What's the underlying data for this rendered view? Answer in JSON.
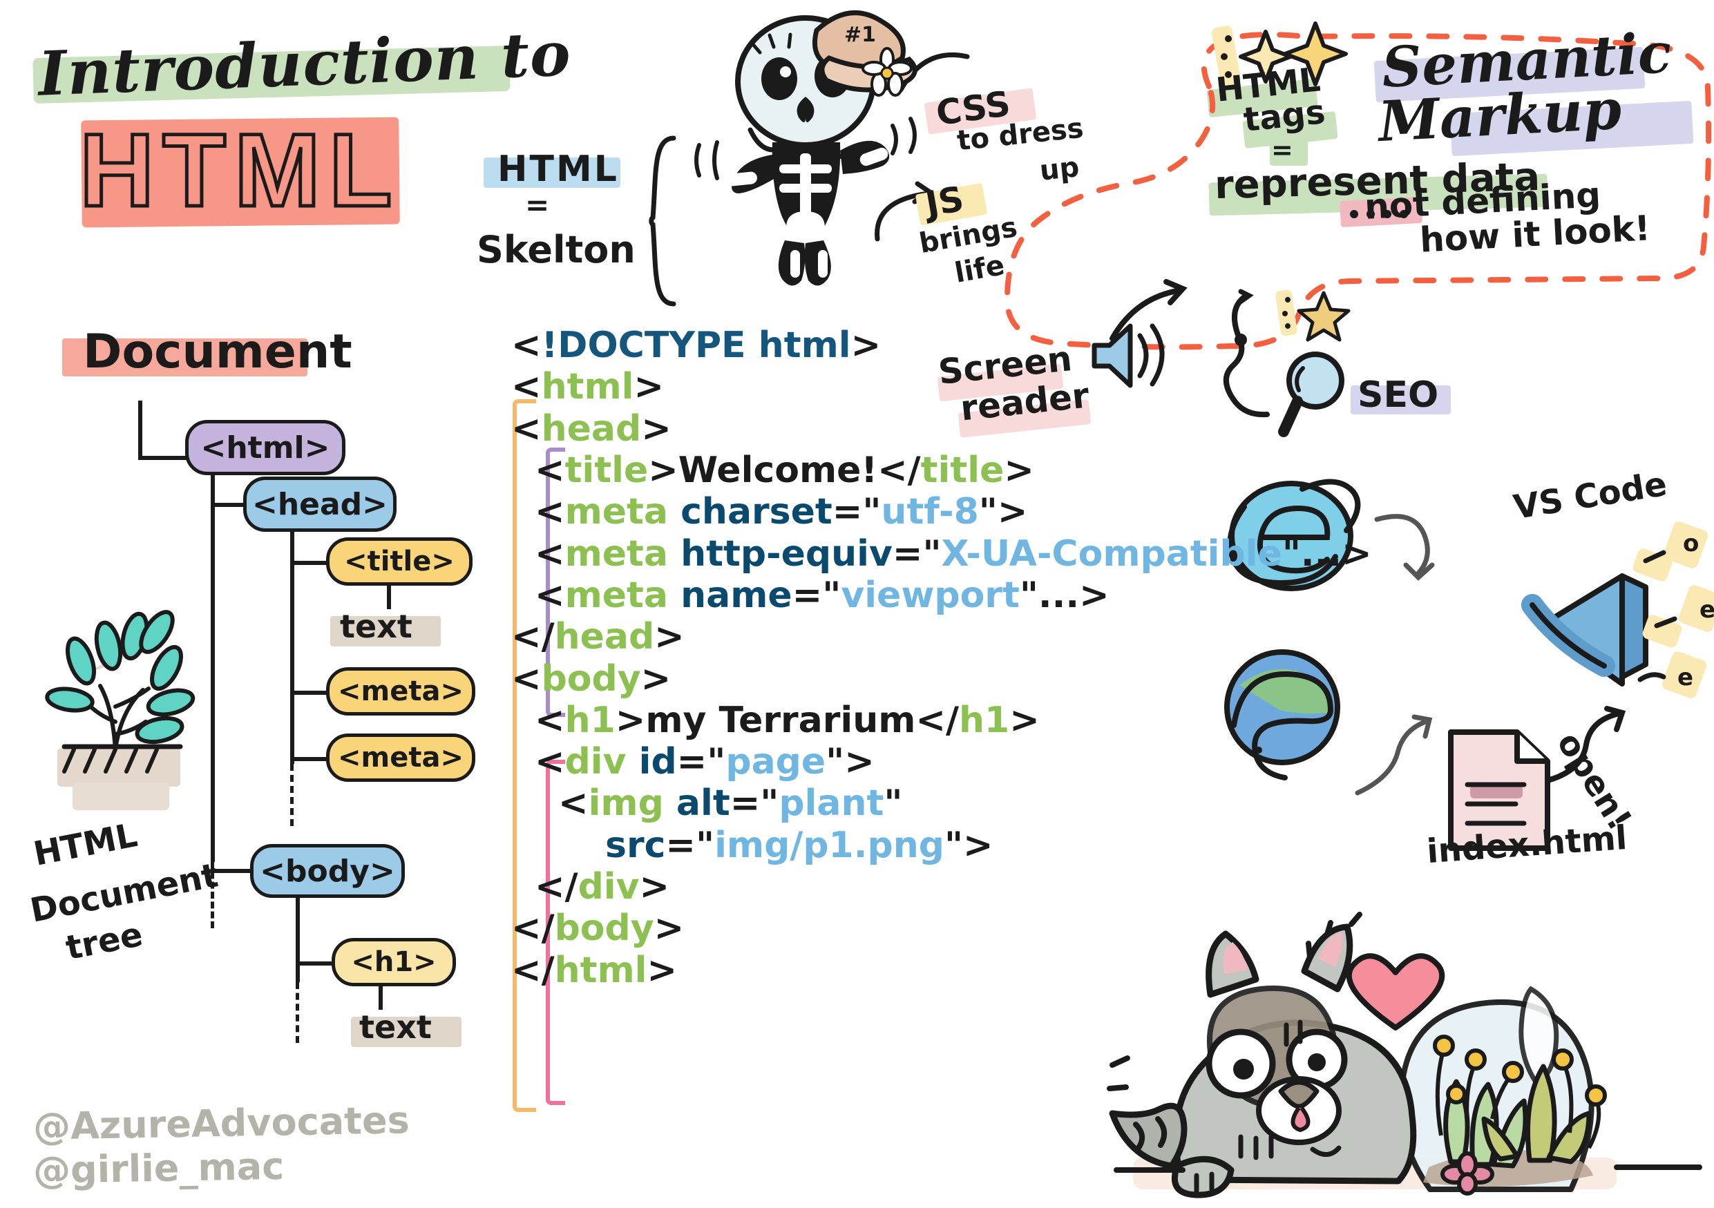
{
  "title": {
    "line1": "Introduction to",
    "line2": "HTML"
  },
  "skeleton_note": {
    "html_label": "HTML",
    "equals": "=",
    "skeleton_label": "Skelton",
    "hat_text": "#1"
  },
  "css_note": {
    "label": "CSS",
    "line1": "to dress",
    "line2": "up"
  },
  "js_note": {
    "label": "JS",
    "line1": "brings",
    "line2": "life"
  },
  "semantic": {
    "heading_line1": "Semantic",
    "heading_line2": "Markup",
    "tags_line1": "HTML",
    "tags_line2": "tags",
    "equals": "=",
    "represent": "represent data",
    "not_defining_line1": "not defining",
    "not_defining_line2": "how it look!",
    "screen_reader_line1": "Screen",
    "screen_reader_line2": "reader",
    "seo": "SEO"
  },
  "document_tree": {
    "heading": "Document",
    "caption_line1": "HTML",
    "caption_line2": "Document",
    "caption_line3": "tree",
    "nodes": [
      {
        "label": "<html>",
        "color": "purple"
      },
      {
        "label": "<head>",
        "color": "blue"
      },
      {
        "label": "<title>",
        "color": "yellow"
      },
      {
        "label": "text",
        "color": "tan"
      },
      {
        "label": "<meta>",
        "color": "yellow"
      },
      {
        "label": "<meta>",
        "color": "yellow"
      },
      {
        "label": "<body>",
        "color": "blue"
      },
      {
        "label": "<h1>",
        "color": "yellow-light"
      },
      {
        "label": "text",
        "color": "tan"
      }
    ]
  },
  "code": {
    "lines": [
      {
        "indent": 0,
        "tokens": [
          {
            "t": "pun",
            "v": "<"
          },
          {
            "t": "doc",
            "v": "!DOCTYPE html"
          },
          {
            "t": "pun",
            "v": ">"
          }
        ]
      },
      {
        "indent": 0,
        "tokens": [
          {
            "t": "pun",
            "v": "<"
          },
          {
            "t": "tag",
            "v": "html"
          },
          {
            "t": "pun",
            "v": ">"
          }
        ]
      },
      {
        "indent": 0,
        "tokens": [
          {
            "t": "pun",
            "v": "<"
          },
          {
            "t": "tag",
            "v": "head"
          },
          {
            "t": "pun",
            "v": ">"
          }
        ]
      },
      {
        "indent": 1,
        "tokens": [
          {
            "t": "pun",
            "v": "<"
          },
          {
            "t": "tag",
            "v": "title"
          },
          {
            "t": "pun",
            "v": ">"
          },
          {
            "t": "pun",
            "v": "Welcome!"
          },
          {
            "t": "pun",
            "v": "</"
          },
          {
            "t": "tag",
            "v": "title"
          },
          {
            "t": "pun",
            "v": ">"
          }
        ]
      },
      {
        "indent": 1,
        "tokens": [
          {
            "t": "pun",
            "v": "<"
          },
          {
            "t": "tag",
            "v": "meta "
          },
          {
            "t": "attr",
            "v": "charset"
          },
          {
            "t": "pun",
            "v": "=\""
          },
          {
            "t": "val",
            "v": "utf-8"
          },
          {
            "t": "pun",
            "v": "\">"
          }
        ]
      },
      {
        "indent": 1,
        "tokens": [
          {
            "t": "pun",
            "v": "<"
          },
          {
            "t": "tag",
            "v": "meta "
          },
          {
            "t": "attr",
            "v": "http-equiv"
          },
          {
            "t": "pun",
            "v": "=\""
          },
          {
            "t": "val",
            "v": "X-UA-Compatible"
          },
          {
            "t": "pun",
            "v": "\"...>"
          }
        ]
      },
      {
        "indent": 1,
        "tokens": [
          {
            "t": "pun",
            "v": "<"
          },
          {
            "t": "tag",
            "v": "meta "
          },
          {
            "t": "attr",
            "v": "name"
          },
          {
            "t": "pun",
            "v": "=\""
          },
          {
            "t": "val",
            "v": "viewport"
          },
          {
            "t": "pun",
            "v": "\"...>"
          }
        ]
      },
      {
        "indent": 0,
        "tokens": [
          {
            "t": "pun",
            "v": "</"
          },
          {
            "t": "tag",
            "v": "head"
          },
          {
            "t": "pun",
            "v": ">"
          }
        ]
      },
      {
        "indent": 0,
        "tokens": [
          {
            "t": "pun",
            "v": "<"
          },
          {
            "t": "tag",
            "v": "body"
          },
          {
            "t": "pun",
            "v": ">"
          }
        ]
      },
      {
        "indent": 1,
        "tokens": [
          {
            "t": "pun",
            "v": "<"
          },
          {
            "t": "tag",
            "v": "h1"
          },
          {
            "t": "pun",
            "v": ">"
          },
          {
            "t": "pun",
            "v": "my Terrarium"
          },
          {
            "t": "pun",
            "v": "</"
          },
          {
            "t": "tag",
            "v": "h1"
          },
          {
            "t": "pun",
            "v": ">"
          }
        ]
      },
      {
        "indent": 1,
        "tokens": [
          {
            "t": "pun",
            "v": "<"
          },
          {
            "t": "tag",
            "v": "div "
          },
          {
            "t": "attr",
            "v": "id"
          },
          {
            "t": "pun",
            "v": "=\""
          },
          {
            "t": "val",
            "v": "page"
          },
          {
            "t": "pun",
            "v": "\">"
          }
        ]
      },
      {
        "indent": 2,
        "tokens": [
          {
            "t": "pun",
            "v": "<"
          },
          {
            "t": "tag",
            "v": "img "
          },
          {
            "t": "attr",
            "v": "alt"
          },
          {
            "t": "pun",
            "v": "=\""
          },
          {
            "t": "val",
            "v": "plant"
          },
          {
            "t": "pun",
            "v": "\""
          }
        ]
      },
      {
        "indent": 4,
        "tokens": [
          {
            "t": "attr",
            "v": "src"
          },
          {
            "t": "pun",
            "v": "=\""
          },
          {
            "t": "val",
            "v": "img/p1.png"
          },
          {
            "t": "pun",
            "v": "\">"
          }
        ]
      },
      {
        "indent": 1,
        "tokens": [
          {
            "t": "pun",
            "v": "</"
          },
          {
            "t": "tag",
            "v": "div"
          },
          {
            "t": "pun",
            "v": ">"
          }
        ]
      },
      {
        "indent": 0,
        "tokens": [
          {
            "t": "pun",
            "v": "</"
          },
          {
            "t": "tag",
            "v": "body"
          },
          {
            "t": "pun",
            "v": ">"
          }
        ]
      },
      {
        "indent": 0,
        "tokens": [
          {
            "t": "pun",
            "v": "</"
          },
          {
            "t": "tag",
            "v": "html"
          },
          {
            "t": "pun",
            "v": ">"
          }
        ]
      }
    ]
  },
  "tools": {
    "vscode_label": "VS Code",
    "index_label": "index.html",
    "open_label": "open!"
  },
  "credits": {
    "line1": "@AzureAdvocates",
    "line2": "@girlie_mac"
  },
  "colors": {
    "tag_green": "#8cc152",
    "attr_navy": "#0a4a6e",
    "value_blue": "#6fb6e3",
    "doctype_blue": "#14567d",
    "html_red": "#f58e7e",
    "highlight_green": "#c9e2bd",
    "highlight_purple": "#d6d5ee",
    "highlight_yellow": "#fae9b0",
    "highlight_pink": "#f8dada",
    "dashed_outline": "#f4603f",
    "ink": "#1b1b1b"
  }
}
